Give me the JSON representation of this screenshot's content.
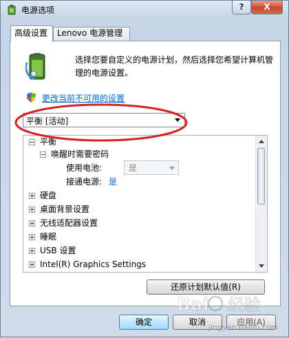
{
  "window": {
    "title": "电源选项",
    "help_label": "?",
    "close_label": "X"
  },
  "tabs": [
    {
      "label": "高级设置",
      "active": true
    },
    {
      "label": "Lenovo 电源管理",
      "active": false
    }
  ],
  "description": "选择您要自定义的电源计划，然后选择您希望计算机管理的电源设置。",
  "change_link": "更改当前不可用的设置",
  "plan_select": {
    "value": "平衡 [活动]"
  },
  "tree": [
    {
      "label": "平衡",
      "expander": "minus"
    },
    {
      "label": "唤醒时需要密码",
      "expander": "minus"
    },
    {
      "label": "使用电池:",
      "select_value": "是"
    },
    {
      "label": "接通电源:",
      "value": "是"
    },
    {
      "label": "硬盘",
      "expander": "plus"
    },
    {
      "label": "桌面背景设置",
      "expander": "plus"
    },
    {
      "label": "无线适配器设置",
      "expander": "plus"
    },
    {
      "label": "睡眠",
      "expander": "plus"
    },
    {
      "label": "USB 设置",
      "expander": "plus"
    },
    {
      "label": "Intel(R) Graphics Settings",
      "expander": "plus"
    }
  ],
  "buttons": {
    "restore": "还原计划默认值(R)",
    "ok": "确定",
    "cancel": "取消",
    "apply": "应用(A)"
  },
  "watermark": {
    "brand": "Bai",
    "text": "经验",
    "url": "jingyan.baidu.com"
  },
  "colors": {
    "link": "#0066cc",
    "highlight_circle": "#d32020",
    "close_button": "#c8452d"
  }
}
